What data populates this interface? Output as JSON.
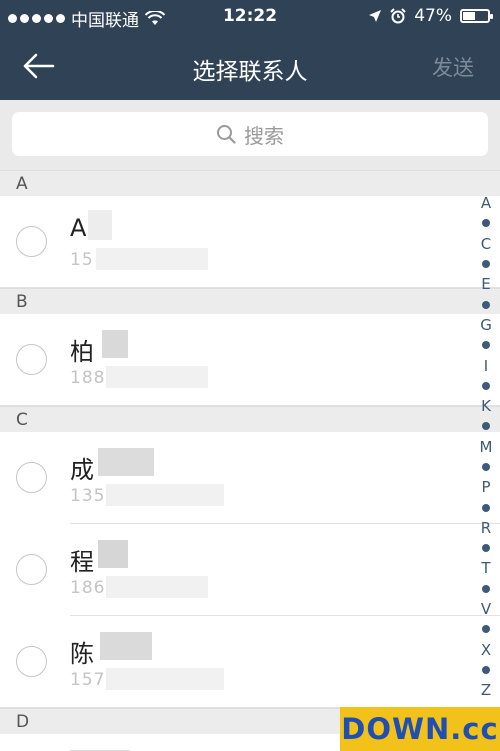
{
  "status_bar": {
    "carrier": "中国联通",
    "time": "12:22",
    "battery": "47%"
  },
  "nav": {
    "title": "选择联系人",
    "send_label": "发送"
  },
  "search": {
    "placeholder": "搜索"
  },
  "sections": [
    {
      "letter": "A",
      "contacts": [
        {
          "name": "A",
          "phone": "15"
        }
      ]
    },
    {
      "letter": "B",
      "contacts": [
        {
          "name": "柏",
          "phone": "188"
        }
      ]
    },
    {
      "letter": "C",
      "contacts": [
        {
          "name": "成",
          "phone": "135"
        },
        {
          "name": "程",
          "phone": "186"
        },
        {
          "name": "陈",
          "phone": "157"
        }
      ]
    },
    {
      "letter": "D",
      "contacts": []
    }
  ],
  "index_bar": [
    "A",
    "C",
    "E",
    "G",
    "I",
    "K",
    "M",
    "P",
    "R",
    "T",
    "V",
    "X",
    "Z"
  ],
  "watermark": "DOWN.cc"
}
